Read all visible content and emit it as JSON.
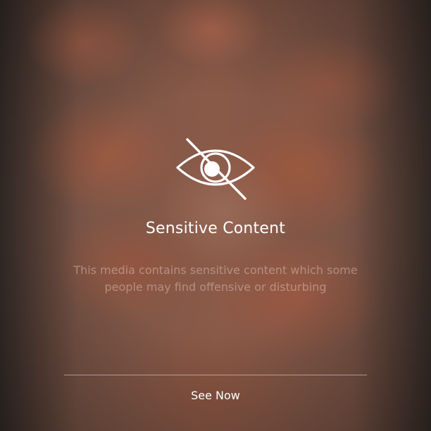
{
  "overlay": {
    "icon": "eye-slash-icon",
    "title": "Sensitive Content",
    "description": "This media contains sensitive content which some people may find offensive or disturbing",
    "action_label": "See Now"
  },
  "colors": {
    "title_text": "#ffffff",
    "description_text": "#b8a49a",
    "divider": "#c9b3a8"
  }
}
